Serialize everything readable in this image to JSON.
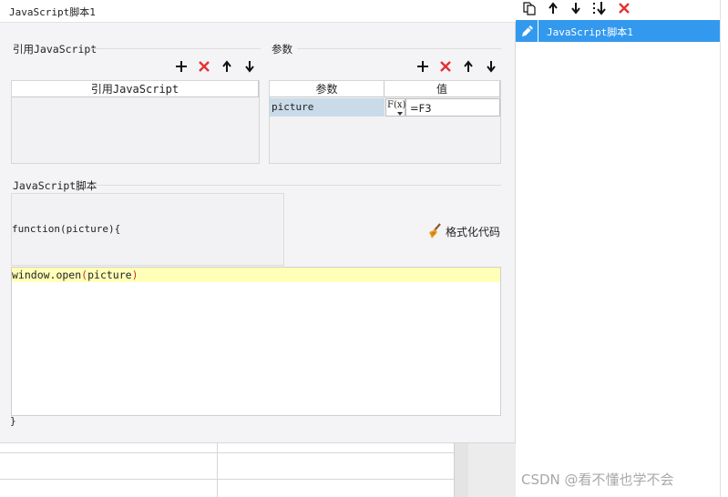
{
  "title_bar": {
    "title": "JavaScript脚本1"
  },
  "imports": {
    "section_label": "引用JavaScript",
    "column_header": "引用JavaScript",
    "toolbar": [
      "add-icon",
      "delete-icon",
      "arrow-up-icon",
      "arrow-down-icon"
    ]
  },
  "params": {
    "section_label": "参数",
    "columns": [
      "参数",
      "值"
    ],
    "rows": [
      {
        "name": "picture",
        "fx_label": "F(x)",
        "value": "=F3"
      }
    ],
    "toolbar": [
      "add-icon",
      "delete-icon",
      "arrow-up-icon",
      "arrow-down-icon"
    ]
  },
  "script": {
    "section_label": "JavaScript脚本",
    "function_header": "function(picture){",
    "format_button": "格式化代码",
    "code": {
      "func": "window.open",
      "open_paren": "(",
      "arg": "picture",
      "close_paren": ")"
    },
    "closing_brace": "}"
  },
  "right_panel": {
    "toolbar": [
      "copy-icon",
      "arrow-up-icon",
      "arrow-down-icon",
      "sort-down-icon",
      "delete-icon"
    ],
    "items": [
      {
        "label": "JavaScript脚本1",
        "selected": true
      }
    ]
  },
  "watermark": "CSDN @看不懂也学不会",
  "colors": {
    "accent": "#3399ee",
    "delete": "#e23232",
    "editor_highlight": "#ffffb8",
    "code_paren": "#cc3333"
  }
}
